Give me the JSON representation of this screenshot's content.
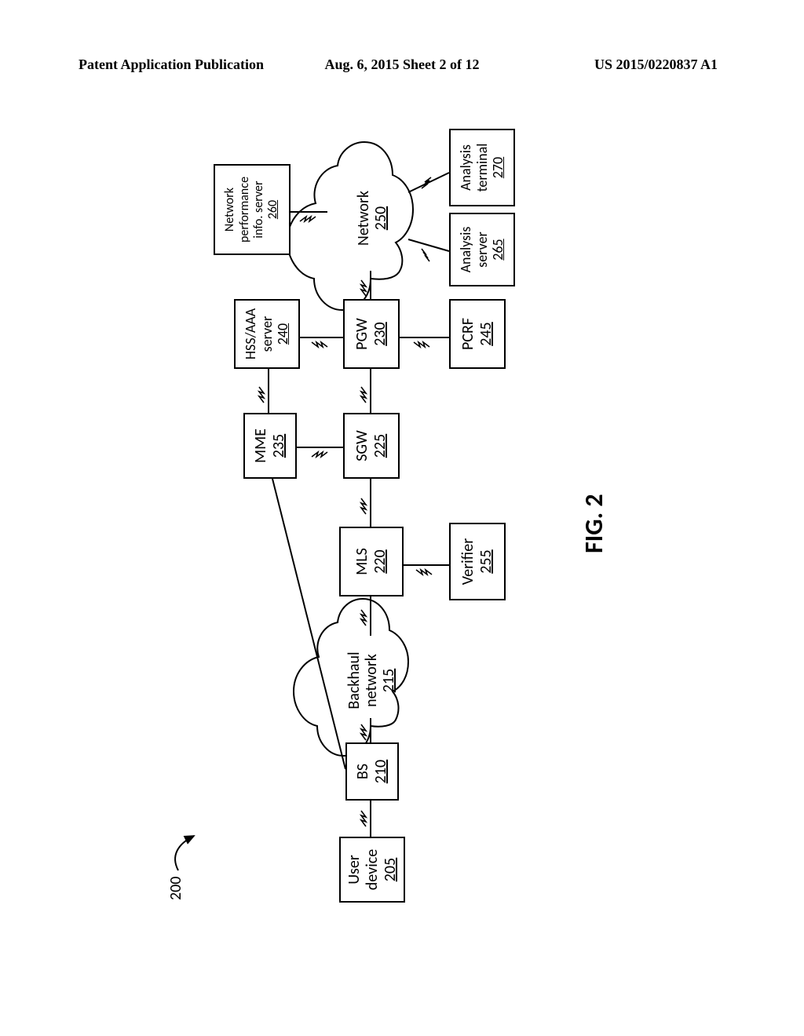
{
  "header": {
    "left": "Patent Application Publication",
    "center": "Aug. 6, 2015  Sheet 2 of 12",
    "right": "US 2015/0220837 A1"
  },
  "figure_ref": "200",
  "figure_label": "FIG. 2",
  "nodes": {
    "user_device": {
      "lines": [
        "User",
        "device"
      ],
      "ref": "205"
    },
    "bs": {
      "lines": [
        "BS"
      ],
      "ref": "210"
    },
    "backhaul": {
      "lines": [
        "Backhaul",
        "network"
      ],
      "ref": "215"
    },
    "mls": {
      "lines": [
        "MLS"
      ],
      "ref": "220"
    },
    "verifier": {
      "lines": [
        "Verifier"
      ],
      "ref": "255"
    },
    "sgw": {
      "lines": [
        "SGW"
      ],
      "ref": "225"
    },
    "mme": {
      "lines": [
        "MME"
      ],
      "ref": "235"
    },
    "hss": {
      "lines": [
        "HSS/AAA",
        "server"
      ],
      "ref": "240"
    },
    "pgw": {
      "lines": [
        "PGW"
      ],
      "ref": "230"
    },
    "pcrf": {
      "lines": [
        "PCRF"
      ],
      "ref": "245"
    },
    "network": {
      "lines": [
        "Network"
      ],
      "ref": "250"
    },
    "perf_server": {
      "lines": [
        "Network",
        "performance",
        "info. server"
      ],
      "ref": "260"
    },
    "analysis_srv": {
      "lines": [
        "Analysis",
        "server"
      ],
      "ref": "265"
    },
    "analysis_term": {
      "lines": [
        "Analysis",
        "terminal"
      ],
      "ref": "270"
    }
  }
}
